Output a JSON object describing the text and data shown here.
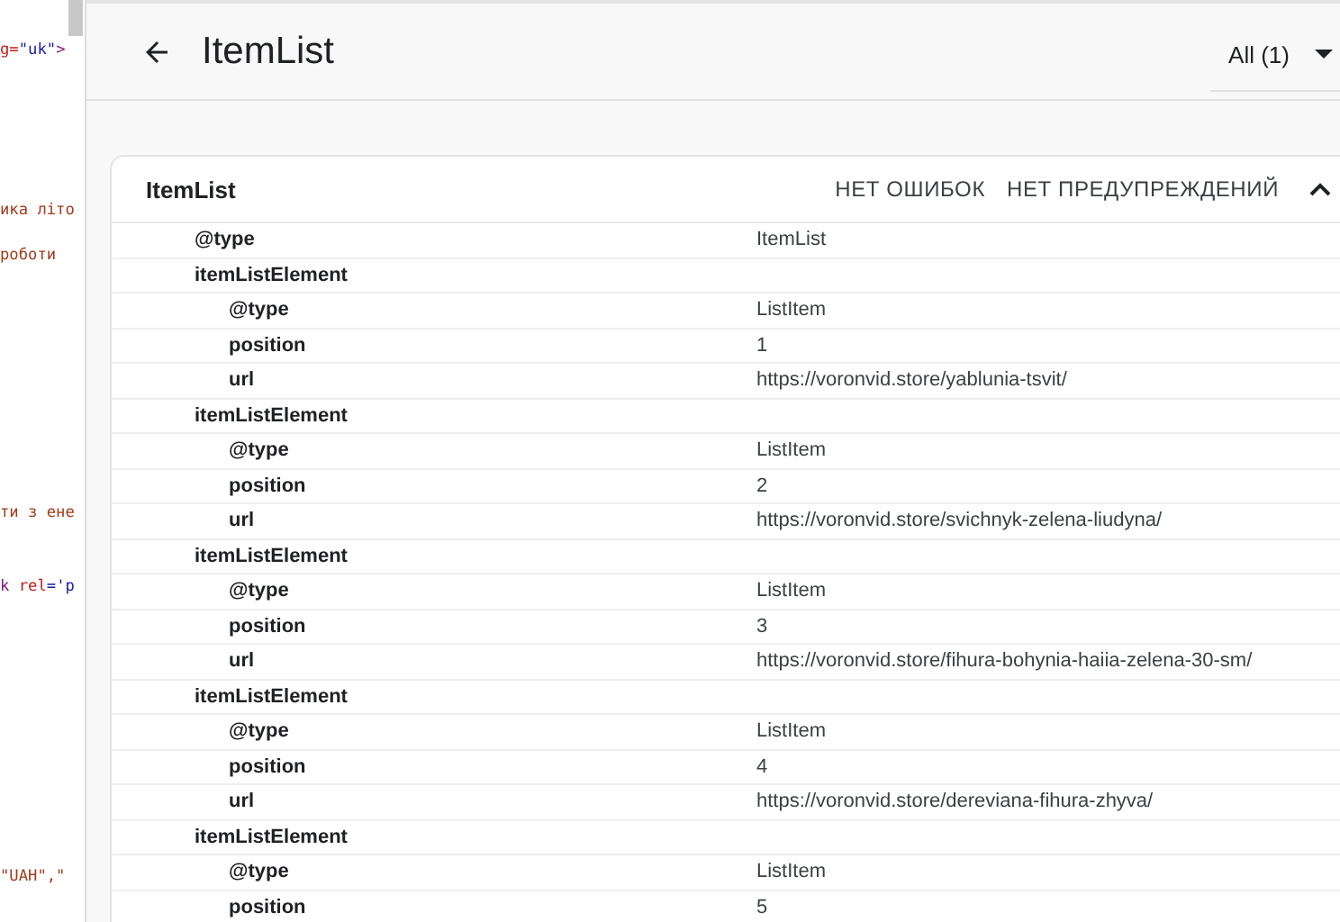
{
  "code_pane": {
    "lines": [
      {
        "segments": [
          {
            "text": "g=",
            "kind": "attr"
          },
          {
            "text": "\"uk\"",
            "kind": "string"
          },
          {
            "text": ">",
            "kind": "tag"
          }
        ]
      },
      {
        "segments": [
          {
            "text": "ика літо",
            "kind": "text"
          }
        ]
      },
      {
        "segments": [
          {
            "text": " роботи",
            "kind": "text"
          }
        ]
      },
      {
        "segments": [
          {
            "text": "ти з ене",
            "kind": "text"
          }
        ]
      },
      {
        "segments": [
          {
            "text": "k",
            "kind": "tag"
          },
          {
            "text": " rel",
            "kind": "attr"
          },
          {
            "text": "='p",
            "kind": "string"
          }
        ]
      },
      {
        "segments": [
          {
            "text": "\"UAH\",\"",
            "kind": "text"
          }
        ]
      }
    ]
  },
  "header": {
    "title": "ItemList",
    "filter": "All (1)"
  },
  "card": {
    "title": "ItemList",
    "errors": "НЕТ ОШИБОК",
    "warnings": "НЕТ ПРЕДУПРЕЖДЕНИЙ",
    "expanded": true,
    "rows": [
      {
        "key": "@type",
        "value": "ItemList"
      },
      {
        "key": "itemListElement",
        "children": [
          {
            "key": "@type",
            "value": "ListItem"
          },
          {
            "key": "position",
            "value": "1"
          },
          {
            "key": "url",
            "value": "https://voronvid.store/yablunia-tsvit/"
          }
        ]
      },
      {
        "key": "itemListElement",
        "children": [
          {
            "key": "@type",
            "value": "ListItem"
          },
          {
            "key": "position",
            "value": "2"
          },
          {
            "key": "url",
            "value": "https://voronvid.store/svichnyk-zelena-liudyna/"
          }
        ]
      },
      {
        "key": "itemListElement",
        "children": [
          {
            "key": "@type",
            "value": "ListItem"
          },
          {
            "key": "position",
            "value": "3"
          },
          {
            "key": "url",
            "value": "https://voronvid.store/fihura-bohynia-haiia-zelena-30-sm/"
          }
        ]
      },
      {
        "key": "itemListElement",
        "children": [
          {
            "key": "@type",
            "value": "ListItem"
          },
          {
            "key": "position",
            "value": "4"
          },
          {
            "key": "url",
            "value": "https://voronvid.store/dereviana-fihura-zhyva/"
          }
        ]
      },
      {
        "key": "itemListElement",
        "children": [
          {
            "key": "@type",
            "value": "ListItem"
          },
          {
            "key": "position",
            "value": "5"
          }
        ]
      }
    ]
  }
}
